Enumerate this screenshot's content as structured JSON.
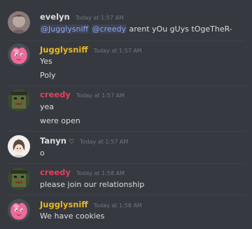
{
  "colors": {
    "background": "#36393f",
    "evelyn": "#dcddde",
    "jugglysniff": "#e8b923",
    "creedy": "#e0415c",
    "tanyn": "#dcddde",
    "mention": "#8fa6f0"
  },
  "messages": [
    {
      "user": "evelyn",
      "time": "Today at 1:57 AM",
      "avatar_icon": "evelyn-avatar",
      "lines": [
        {
          "mentions": [
            "@Jugglysniff",
            "@creedy"
          ],
          "text": " arent yOu gUys tOgeTheR-"
        }
      ]
    },
    {
      "user": "Jugglysniff",
      "time": "Today at 1:57 AM",
      "avatar_icon": "pink-pokemon-avatar",
      "lines": [
        {
          "text": "Yes"
        },
        {
          "text": "Poly"
        }
      ]
    },
    {
      "user": "creedy",
      "time": "Today at 1:57 AM",
      "avatar_icon": "creedy-avatar",
      "lines": [
        {
          "text": "yea"
        },
        {
          "text": "were open"
        }
      ]
    },
    {
      "user": "Tanyn",
      "heart": "♡",
      "time": "Today at 1:57 AM",
      "avatar_icon": "tanyn-avatar",
      "lines": [
        {
          "text": "o"
        }
      ]
    },
    {
      "user": "creedy",
      "time": "Today at 1:58 AM",
      "avatar_icon": "creedy-avatar",
      "lines": [
        {
          "text": "please join our relationship"
        }
      ]
    },
    {
      "user": "Jugglysniff",
      "time": "Today at 1:58 AM",
      "avatar_icon": "pink-pokemon-avatar",
      "lines": [
        {
          "text": "We have cookies"
        }
      ]
    }
  ]
}
